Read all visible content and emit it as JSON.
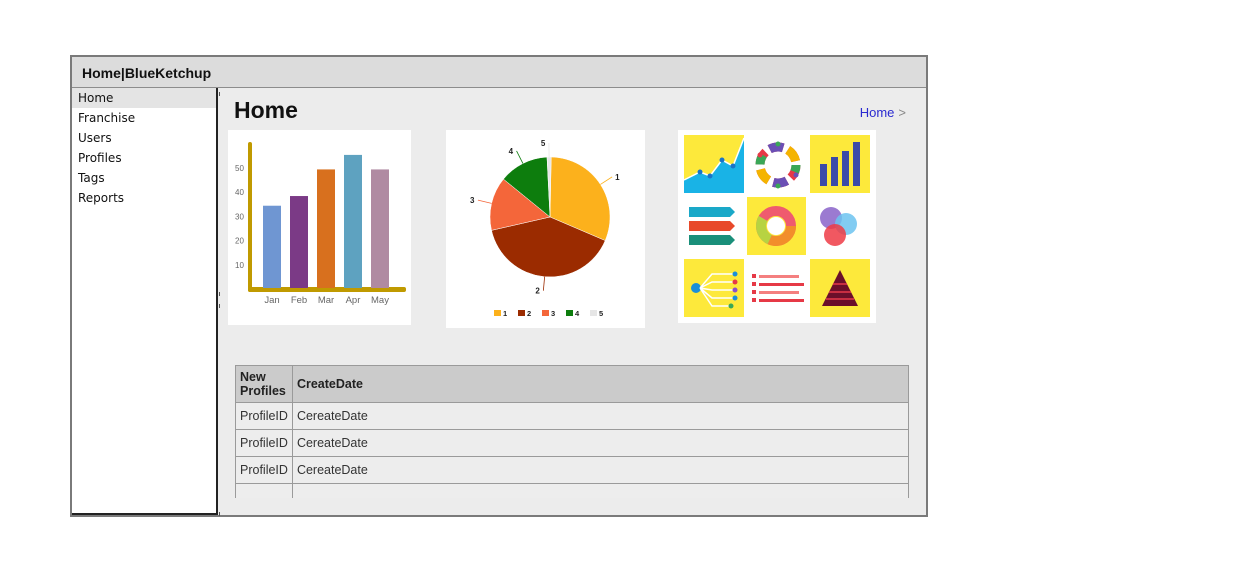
{
  "app": {
    "title": "Home|BlueKetchup"
  },
  "sidebar": {
    "items": [
      {
        "label": "Home"
      },
      {
        "label": "Franchise"
      },
      {
        "label": "Users"
      },
      {
        "label": "Profiles"
      },
      {
        "label": "Tags"
      },
      {
        "label": "Reports"
      }
    ]
  },
  "page": {
    "title": "Home"
  },
  "breadcrumb": {
    "home": "Home",
    "separator": ">"
  },
  "bar_image": {
    "categories": [
      "Jan",
      "Feb",
      "Mar",
      "Apr",
      "May"
    ],
    "y_ticks": [
      "50",
      "40",
      "30",
      "20",
      "10"
    ],
    "values": [
      34,
      38,
      49,
      55,
      49
    ],
    "colors": [
      "#6f96d2",
      "#7b3a86",
      "#d8701e",
      "#5ea2c0",
      "#b08aa2"
    ],
    "axis_color": "#c09a00"
  },
  "pie_image": {
    "slices": [
      {
        "label": "1",
        "value": 28,
        "color": "#fcb11c"
      },
      {
        "label": "2",
        "value": 36,
        "color": "#9b2b00"
      },
      {
        "label": "3",
        "value": 13,
        "color": "#f4663a"
      },
      {
        "label": "4",
        "value": 12,
        "color": "#0d7d0d"
      },
      {
        "label": "5",
        "value": 1,
        "color": "#e6e6e6"
      }
    ]
  },
  "table": {
    "headers": [
      "New Profiles",
      "CreateDate"
    ],
    "rows": [
      [
        "ProfileID",
        "CereateDate"
      ],
      [
        "ProfileID",
        "CereateDate"
      ],
      [
        "ProfileID",
        "CereateDate"
      ],
      [
        "",
        ""
      ]
    ]
  }
}
